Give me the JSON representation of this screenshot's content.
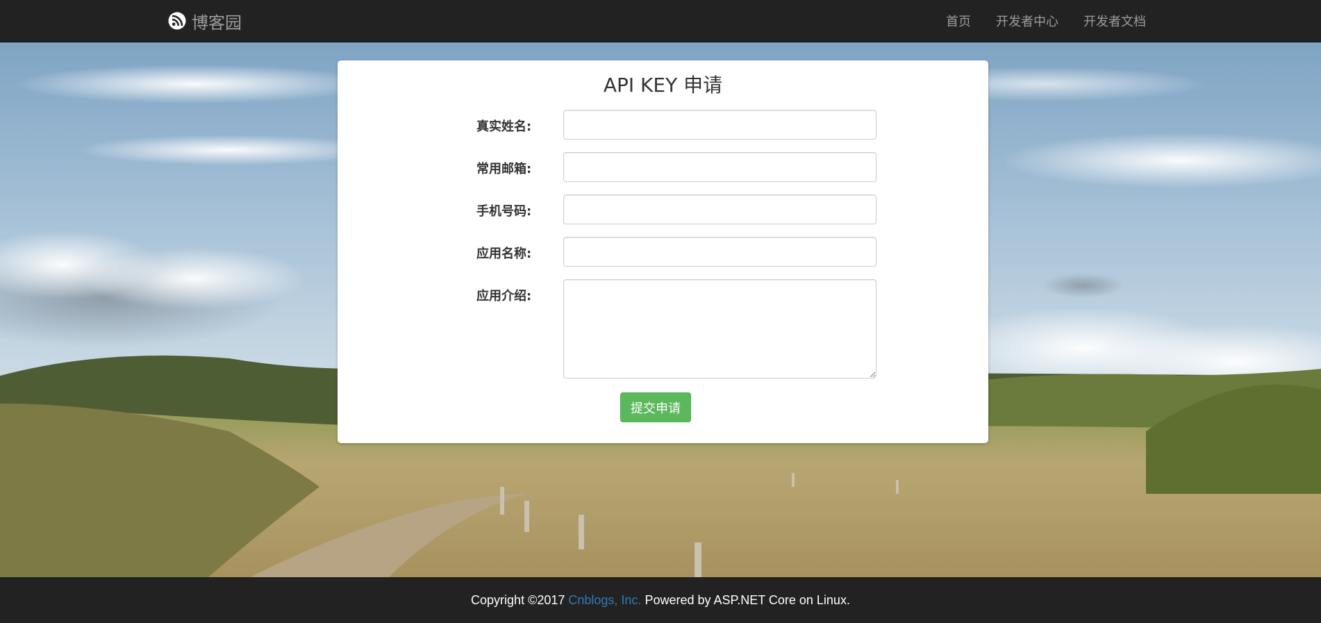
{
  "navbar": {
    "brand_text": "博客园",
    "brand_icon": "cnblogs-logo-icon",
    "links": [
      {
        "label": "首页"
      },
      {
        "label": "开发者中心"
      },
      {
        "label": "开发者文档"
      }
    ]
  },
  "form": {
    "title": "API KEY 申请",
    "fields": [
      {
        "label": "真实姓名:",
        "value": "",
        "placeholder": ""
      },
      {
        "label": "常用邮箱:",
        "value": "",
        "placeholder": ""
      },
      {
        "label": "手机号码:",
        "value": "",
        "placeholder": ""
      },
      {
        "label": "应用名称:",
        "value": "",
        "placeholder": ""
      },
      {
        "label": "应用介绍:",
        "value": "",
        "placeholder": ""
      }
    ],
    "submit_label": "提交申请"
  },
  "footer": {
    "prefix": "Copyright ©2017 ",
    "company_link": "Cnblogs, Inc.",
    "suffix": " Powered by ASP.NET Core on Linux."
  },
  "colors": {
    "navbar_bg": "#222222",
    "nav_text": "#9d9d9d",
    "submit_green": "#5cb85c",
    "link_blue": "#337ab7"
  }
}
